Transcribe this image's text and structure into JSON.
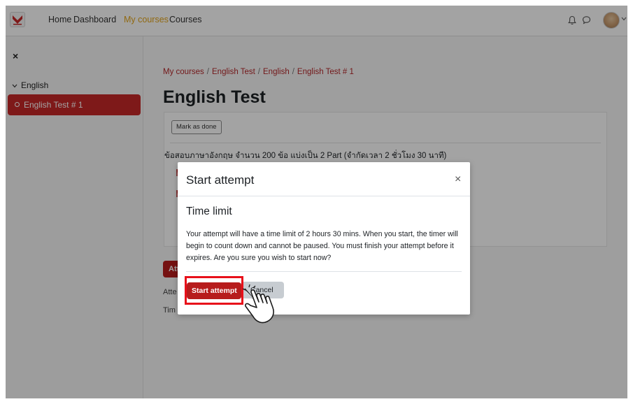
{
  "navbar": {
    "links": [
      "Home",
      "Dashboard",
      "My courses",
      "Courses"
    ],
    "active_link": "My courses",
    "icons": [
      "bell-icon",
      "chat-icon",
      "user-avatar",
      "chevron-down-icon"
    ]
  },
  "drawer": {
    "close_icon": "×",
    "section_label": "English",
    "active_item": "English Test # 1"
  },
  "breadcrumb": [
    "My courses",
    "English Test",
    "English",
    "English Test # 1"
  ],
  "page_title": "English Test",
  "activity": {
    "mark_done_label": "Mark as done",
    "description": "ข้อสอบภาษาอังกฤษ จำนวน 200 ข้อ แบ่งเป็น 2 Part (จำกัดเวลา 2 ชั่วโมง 30 นาที)"
  },
  "behind": {
    "attempt_btn_fragment": "Att",
    "line1_fragment": "Atte",
    "line2_fragment": "Tim"
  },
  "modal": {
    "title": "Start attempt",
    "close": "×",
    "subtitle": "Time limit",
    "body": "Your attempt will have a time limit of 2 hours 30 mins. When you start, the timer will begin to count down and cannot be paused. You must finish your attempt before it expires. Are you sure you wish to start now?",
    "start_label": "Start attempt",
    "cancel_label": "Cancel"
  },
  "colors": {
    "brand_red": "#b71c1c",
    "active_nav": "#e3a51c",
    "highlight": "#e8101a"
  }
}
